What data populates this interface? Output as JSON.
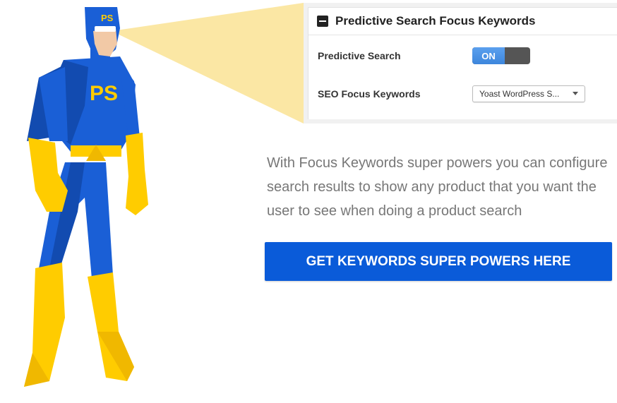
{
  "panel": {
    "title": "Predictive Search Focus Keywords",
    "predictive_search_label": "Predictive Search",
    "toggle_state": "ON",
    "seo_label": "SEO Focus Keywords",
    "seo_select_value": "Yoast WordPress S..."
  },
  "hero": {
    "chest_logo": "PS",
    "mask_logo": "PS"
  },
  "description": "With Focus Keywords super powers you can configure search results to show any product that you want the user to see when doing a product search",
  "cta_label": "GET KEYWORDS SUPER POWERS HERE",
  "colors": {
    "primary_button": "#0a5bd9",
    "toggle_on": "#4a90e2",
    "hero_blue": "#1a5fd6",
    "hero_yellow": "#ffcc00",
    "beam": "#fbe49a"
  }
}
